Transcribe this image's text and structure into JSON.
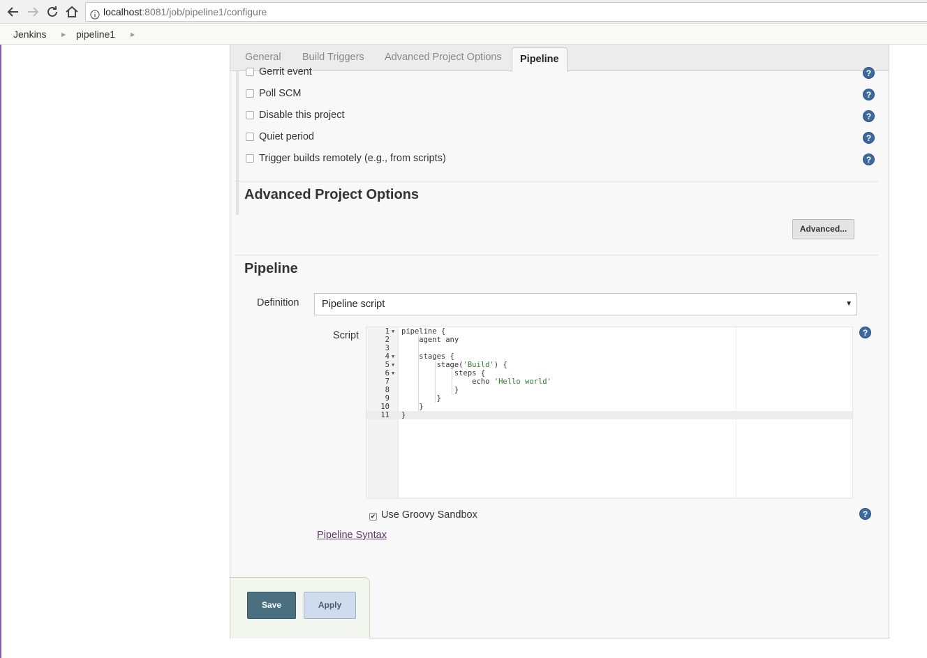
{
  "browser": {
    "url_host": "localhost",
    "url_path": ":8081/job/pipeline1/configure"
  },
  "breadcrumb": {
    "items": [
      {
        "label": "Jenkins"
      },
      {
        "label": "pipeline1"
      }
    ]
  },
  "tabs": [
    {
      "label": "General"
    },
    {
      "label": "Build Triggers"
    },
    {
      "label": "Advanced Project Options"
    },
    {
      "label": "Pipeline",
      "active": true
    }
  ],
  "build_triggers": {
    "options": [
      {
        "label": "Gerrit event",
        "checked": false
      },
      {
        "label": "Poll SCM",
        "checked": false
      },
      {
        "label": "Disable this project",
        "checked": false
      },
      {
        "label": "Quiet period",
        "checked": false
      },
      {
        "label": "Trigger builds remotely (e.g., from scripts)",
        "checked": false
      }
    ]
  },
  "advanced_options": {
    "title": "Advanced Project Options",
    "advanced_button": "Advanced..."
  },
  "pipeline": {
    "title": "Pipeline",
    "definition_label": "Definition",
    "definition_value": "Pipeline script",
    "script_label": "Script",
    "script_lines": [
      {
        "num": "1",
        "code": "pipeline {",
        "fold": true
      },
      {
        "num": "2",
        "code": "    agent any",
        "fold": false
      },
      {
        "num": "3",
        "code": "",
        "fold": false
      },
      {
        "num": "4",
        "code": "    stages {",
        "fold": true
      },
      {
        "num": "5",
        "code": "        stage('Build') {",
        "fold": true
      },
      {
        "num": "6",
        "code": "            steps {",
        "fold": true
      },
      {
        "num": "7",
        "code": "                echo 'Hello world'",
        "fold": false
      },
      {
        "num": "8",
        "code": "            }",
        "fold": false
      },
      {
        "num": "9",
        "code": "        }",
        "fold": false
      },
      {
        "num": "10",
        "code": "    }",
        "fold": false
      },
      {
        "num": "11",
        "code": "}",
        "fold": false
      }
    ],
    "sandbox_label": "Use Groovy Sandbox",
    "sandbox_checked": true,
    "syntax_link": "Pipeline Syntax"
  },
  "actions": {
    "save": "Save",
    "apply": "Apply"
  },
  "help_glyph": "?",
  "colors": {
    "save_button": "#4a6f7f",
    "apply_button": "#cfdcee",
    "help_icon": "#3d6a9e",
    "link": "#5c3566",
    "string_literal": "#2e7d32"
  }
}
